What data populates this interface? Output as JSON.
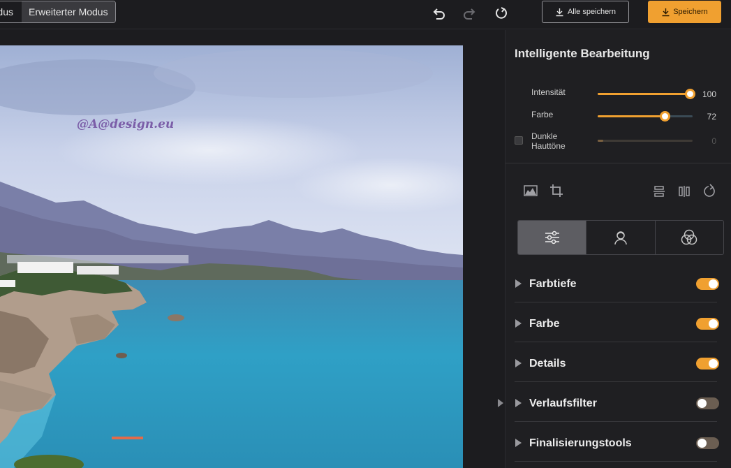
{
  "topbar": {
    "mode_simple_label": "dus",
    "mode_advanced_label": "Erweiterter Modus",
    "undo_icon": "undo-icon",
    "redo_icon": "redo-icon",
    "reset_icon": "reset-icon",
    "save_all_label": "Alle speichern",
    "save_label": "Speichern"
  },
  "canvas": {
    "watermark": "@A@design.eu"
  },
  "panel": {
    "title": "Intelligente Bearbeitung",
    "sliders": [
      {
        "label": "Intensität",
        "value": 100,
        "max": 100,
        "display": "100"
      },
      {
        "label": "Farbe",
        "value": 72,
        "max": 100,
        "display": "72"
      },
      {
        "label": "Dunkle Hauttöne",
        "value": 0,
        "max": 100,
        "display": "0",
        "enabled": false
      }
    ],
    "tools_left": [
      "histogram-icon",
      "crop-icon"
    ],
    "tools_right": [
      "flip-vertical-icon",
      "flip-horizontal-icon",
      "rotate-icon"
    ],
    "tabs": [
      {
        "icon": "sliders-icon",
        "active": true
      },
      {
        "icon": "portrait-icon",
        "active": false
      },
      {
        "icon": "color-circles-icon",
        "active": false
      }
    ],
    "sections": [
      {
        "label": "Farbtiefe",
        "enabled": true
      },
      {
        "label": "Farbe",
        "enabled": true
      },
      {
        "label": "Details",
        "enabled": true
      },
      {
        "label": "Verlaufsfilter",
        "enabled": false
      },
      {
        "label": "Finalisierungstools",
        "enabled": false
      }
    ]
  },
  "colors": {
    "accent": "#f0a030",
    "background": "#1c1c1f",
    "panel": "#1f1f22"
  }
}
